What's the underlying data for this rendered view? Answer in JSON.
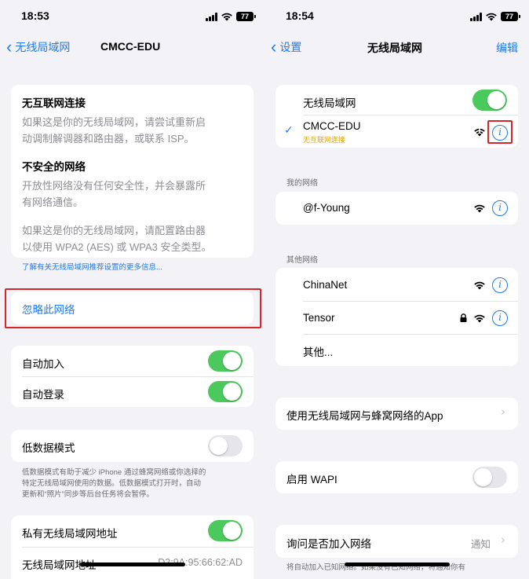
{
  "left": {
    "status_time": "18:53",
    "battery": "77",
    "nav_back": "无线局域网",
    "nav_title": "CMCC-EDU",
    "warning1_title": "无互联网连接",
    "warning1_line1": "如果这是你的无线局域网，请尝试重新启",
    "warning1_line2": "动调制解调器和路由器，或联系 ISP。",
    "warning2_title": "不安全的网络",
    "warning2_line1": "开放性网络没有任何安全性，并会暴露所",
    "warning2_line2": "有网络通信。",
    "warning2_line3": "如果这是你的无线局域网，请配置路由器",
    "warning2_line4": "以使用 WPA2 (AES) 或 WPA3 安全类型。",
    "more_info_link": "了解有关无线局域网推荐设置的更多信息...",
    "forget_network": "忽略此网络",
    "auto_join": "自动加入",
    "auto_join_on": true,
    "auto_login": "自动登录",
    "auto_login_on": true,
    "low_data_mode": "低数据模式",
    "low_data_on": false,
    "low_data_note1": "低数据模式有助于减少 iPhone 通过蜂窝网络或你选择的",
    "low_data_note2": "特定无线局域网使用的数据。低数据模式打开时，自动",
    "low_data_note3": "更新和“照片”同步等后台任务将会暂停。",
    "private_address": "私有无线局域网地址",
    "private_address_on": true,
    "wifi_address_label": "无线局域网地址",
    "wifi_address_value": "D2:9A:95:66:62:AD"
  },
  "right": {
    "status_time": "18:54",
    "battery": "77",
    "nav_back": "设置",
    "nav_title": "无线局域网",
    "nav_edit": "编辑",
    "wifi_label": "无线局域网",
    "wifi_on": true,
    "connected_name": "CMCC-EDU",
    "connected_status": "无互联网连接",
    "my_networks_header": "我的网络",
    "my_network_1": "@f-Young",
    "other_networks_header": "其他网络",
    "other_network_1": "ChinaNet",
    "other_network_2": "Tensor",
    "other_network_other": "其他...",
    "apps_using": "使用无线局域网与蜂窝网络的App",
    "wapi_label": "启用 WAPI",
    "wapi_on": false,
    "ask_join_label": "询问是否加入网络",
    "ask_join_value": "通知",
    "ask_join_note": "将自动加入已知网络。如果没有已知网络，将通知你有"
  },
  "colors": {
    "accent": "#1e7af0",
    "toggle_on": "#4cc95d",
    "toggle_off": "#e5e5ea",
    "highlight": "#d7262b",
    "warning_status": "#e5a000",
    "background": "#f2f2f7"
  }
}
